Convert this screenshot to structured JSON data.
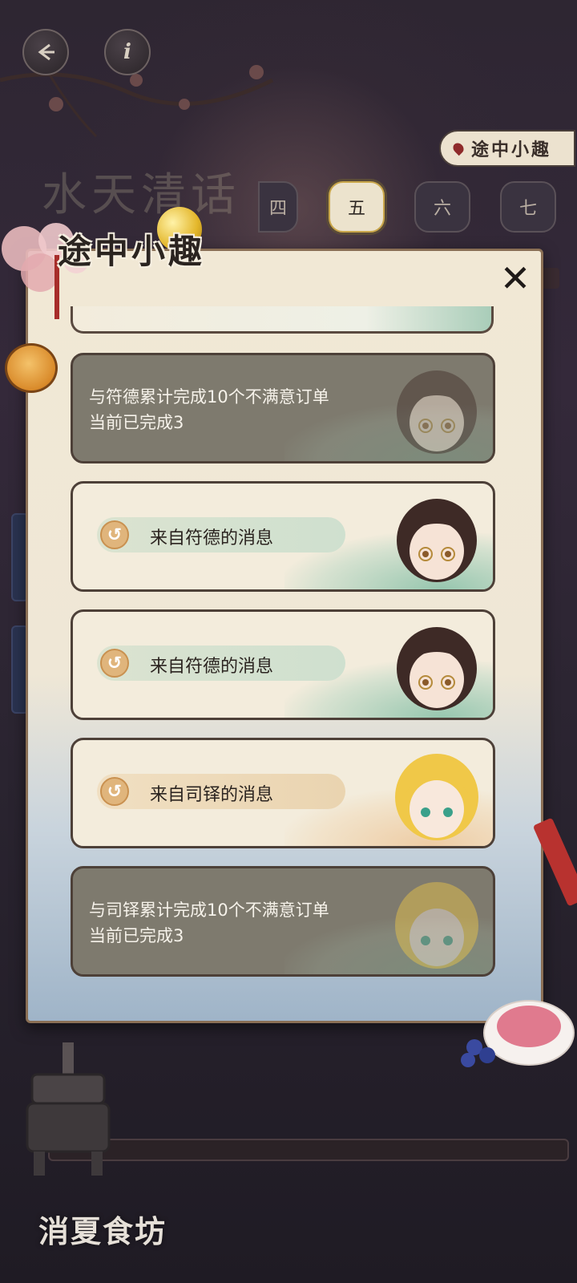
{
  "header": {
    "back_icon": "back-arrow-icon",
    "info_icon": "info-icon",
    "info_glyph": "i",
    "trip_tag_label": "途中小趣"
  },
  "background": {
    "chapter_title": "水天清话",
    "chapters": [
      {
        "label": "四",
        "active": false
      },
      {
        "label": "五",
        "active": true
      },
      {
        "label": "六",
        "active": false
      },
      {
        "label": "七",
        "active": false
      }
    ],
    "shop_name": "消夏食坊"
  },
  "dialog": {
    "title": "途中小趣",
    "close_glyph": "✕",
    "items": [
      {
        "type": "task",
        "line1": "与符德累计完成10个不满意订单",
        "line2": "当前已完成3",
        "character": "符德",
        "hair": "#3e2a26"
      },
      {
        "type": "message",
        "label": "来自符德的消息",
        "icon": "replay-icon",
        "glyph": "↺",
        "character": "符德",
        "hair": "#3e2a26"
      },
      {
        "type": "message",
        "label": "来自符德的消息",
        "icon": "replay-icon",
        "glyph": "↺",
        "character": "符德",
        "hair": "#3e2a26"
      },
      {
        "type": "message",
        "label": "来自司铎的消息",
        "icon": "replay-icon",
        "glyph": "↺",
        "character": "司铎",
        "hair": "#f0c848"
      },
      {
        "type": "task",
        "line1": "与司铎累计完成10个不满意订单",
        "line2": "当前已完成3",
        "character": "司铎",
        "hair": "#f0c848"
      }
    ]
  },
  "colors": {
    "accent_red": "#a72d2a",
    "paper": "#f3ecdc",
    "locked_card": "#7e7a6e",
    "green_wash": "#78baa0"
  }
}
